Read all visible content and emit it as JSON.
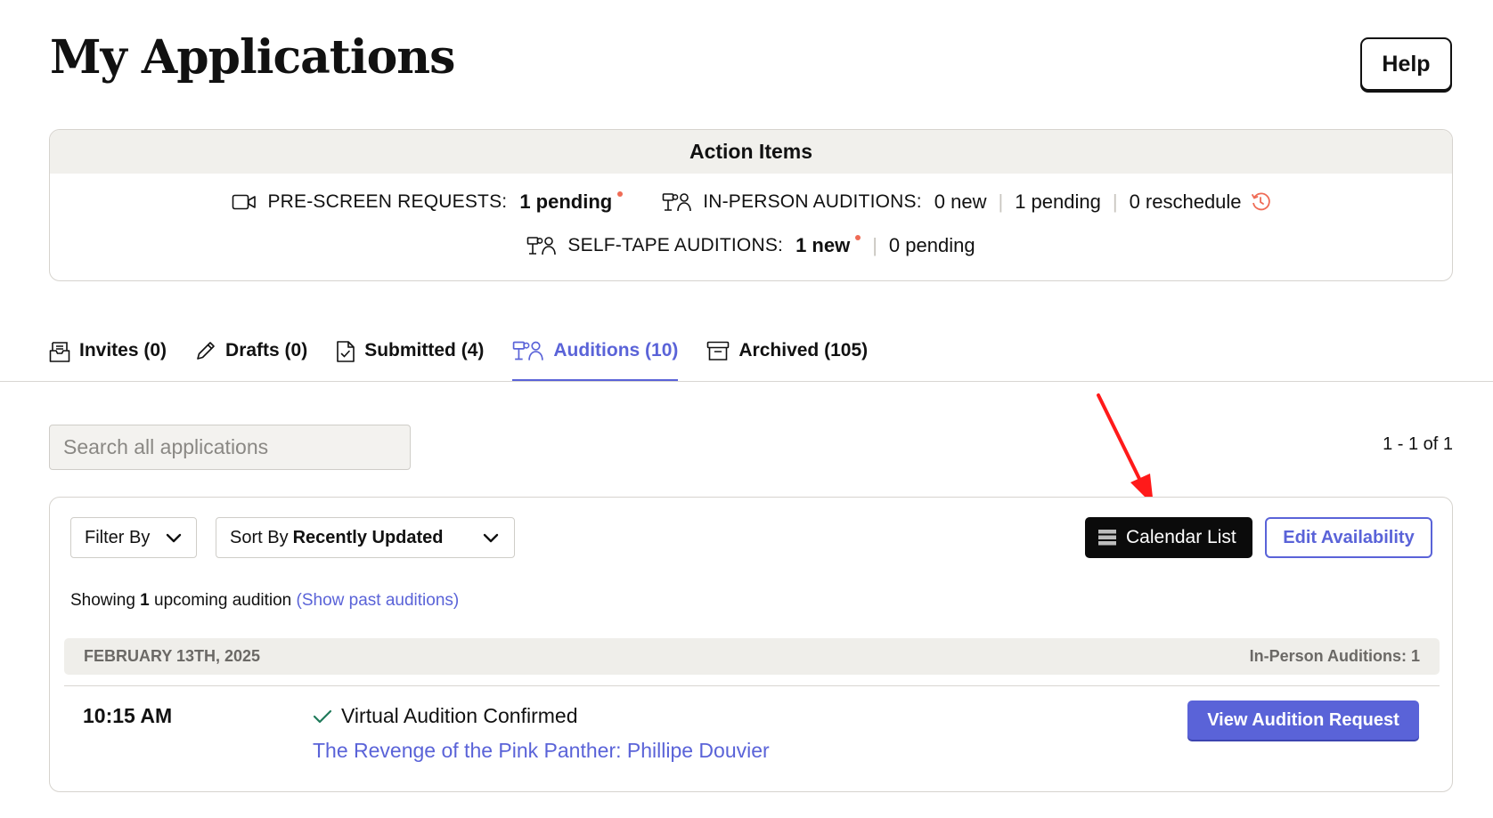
{
  "header": {
    "title": "My Applications",
    "help_label": "Help"
  },
  "action_items": {
    "title": "Action Items",
    "prescreen": {
      "label": "PRE-SCREEN REQUESTS:",
      "pending": "1 pending"
    },
    "in_person": {
      "label": "IN-PERSON AUDITIONS:",
      "new": "0 new",
      "pending": "1 pending",
      "reschedule": "0 reschedule"
    },
    "self_tape": {
      "label": "SELF-TAPE AUDITIONS:",
      "new": "1 new",
      "pending": "0 pending"
    },
    "separator": "|"
  },
  "tabs": [
    {
      "label": "Invites (0)",
      "icon": "inbox-icon"
    },
    {
      "label": "Drafts (0)",
      "icon": "pencil-icon"
    },
    {
      "label": "Submitted (4)",
      "icon": "document-icon"
    },
    {
      "label": "Auditions (10)",
      "icon": "audition-icon",
      "active": true
    },
    {
      "label": "Archived (105)",
      "icon": "archive-icon"
    }
  ],
  "search": {
    "placeholder": "Search all applications",
    "value": ""
  },
  "pagination": {
    "text": "1 - 1 of 1"
  },
  "toolbar": {
    "filter_label": "Filter By",
    "sort_prefix": "Sort By",
    "sort_value": "Recently Updated",
    "calendar_list_label": "Calendar List",
    "edit_availability_label": "Edit Availability"
  },
  "summary": {
    "prefix": "Showing",
    "count": "1",
    "suffix": "upcoming audition",
    "past_link": "(Show past auditions)"
  },
  "date_group": {
    "date": "FEBRUARY 13TH, 2025",
    "count_label": "In-Person Auditions: 1"
  },
  "audition": {
    "time": "10:15 AM",
    "status": "Virtual Audition Confirmed",
    "project": "The Revenge of the Pink Panther: Phillipe Douvier",
    "action_label": "View Audition Request"
  },
  "colors": {
    "accent": "#5a63d8",
    "alert": "#ef6b55",
    "confirmed_check": "#1f7a5a",
    "dark_button": "#0b0b0b",
    "annotation_arrow": "#ff1a1a"
  }
}
